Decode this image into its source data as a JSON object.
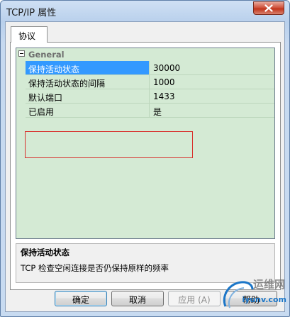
{
  "window": {
    "title": "TCP/IP 属性"
  },
  "tabs": [
    {
      "label": "协议"
    }
  ],
  "grid": {
    "category": "General",
    "rows": [
      {
        "name": "保持活动状态",
        "value": "30000",
        "selected": true
      },
      {
        "name": "保持活动状态的间隔",
        "value": "1000",
        "selected": false
      },
      {
        "name": "默认端口",
        "value": "1433",
        "selected": false
      },
      {
        "name": "已启用",
        "value": "是",
        "selected": false
      }
    ]
  },
  "description": {
    "title": "保持活动状态",
    "text": "TCP 检查空闲连接是否仍保持原样的频率"
  },
  "buttons": {
    "ok": "确定",
    "cancel": "取消",
    "apply": "应用 (A)",
    "help": "帮助"
  },
  "watermark": {
    "line1": "运维网",
    "line2": "iyunv.com"
  },
  "colors": {
    "selection": "#3399ff",
    "grid_bg": "#d4ead4",
    "highlight": "#d8302c"
  }
}
